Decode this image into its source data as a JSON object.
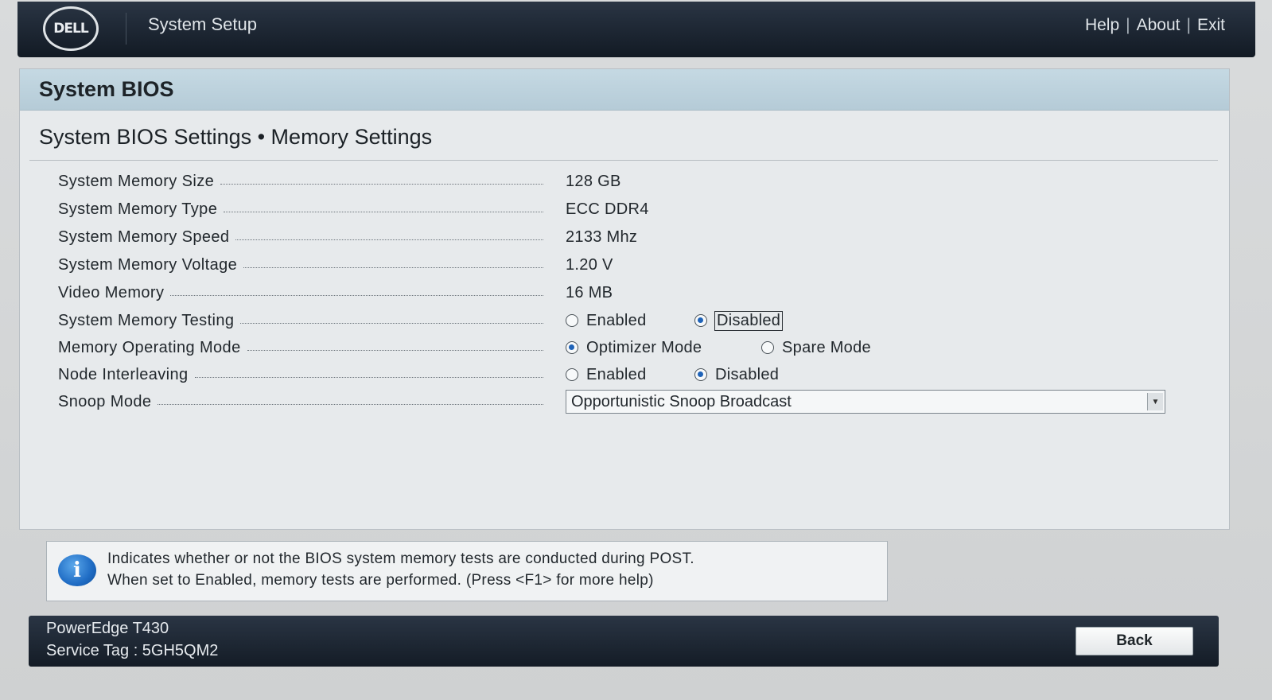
{
  "header": {
    "logo_text": "DELL",
    "title": "System Setup",
    "links": [
      "Help",
      "About",
      "Exit"
    ]
  },
  "panel": {
    "title": "System BIOS",
    "subtitle": "System BIOS Settings • Memory Settings"
  },
  "settings": {
    "memory_size": {
      "label": "System Memory Size",
      "value": "128 GB"
    },
    "memory_type": {
      "label": "System Memory Type",
      "value": "ECC DDR4"
    },
    "memory_speed": {
      "label": "System Memory Speed",
      "value": "2133 Mhz"
    },
    "memory_voltage": {
      "label": "System Memory Voltage",
      "value": "1.20 V"
    },
    "video_memory": {
      "label": "Video Memory",
      "value": "16 MB"
    },
    "memory_testing": {
      "label": "System Memory Testing",
      "options": [
        "Enabled",
        "Disabled"
      ],
      "selected": "Disabled"
    },
    "operating_mode": {
      "label": "Memory Operating Mode",
      "options": [
        "Optimizer Mode",
        "Spare Mode"
      ],
      "selected": "Optimizer Mode"
    },
    "node_interleaving": {
      "label": "Node Interleaving",
      "options": [
        "Enabled",
        "Disabled"
      ],
      "selected": "Disabled"
    },
    "snoop_mode": {
      "label": "Snoop Mode",
      "value": "Opportunistic Snoop Broadcast"
    }
  },
  "info": {
    "line1": "Indicates whether or not the BIOS system memory tests are conducted during POST.",
    "line2": "When set to Enabled, memory tests are performed. (Press <F1> for more help)",
    "icon": "info-icon"
  },
  "footer": {
    "model": "PowerEdge T430",
    "service_tag": "Service Tag : 5GH5QM2",
    "back_label": "Back"
  },
  "colors": {
    "header_bg": "#1b2431",
    "panel_header_bg": "#bdd1dc",
    "radio_selected": "#1f63b8",
    "info_icon": "#1f6cc4"
  }
}
